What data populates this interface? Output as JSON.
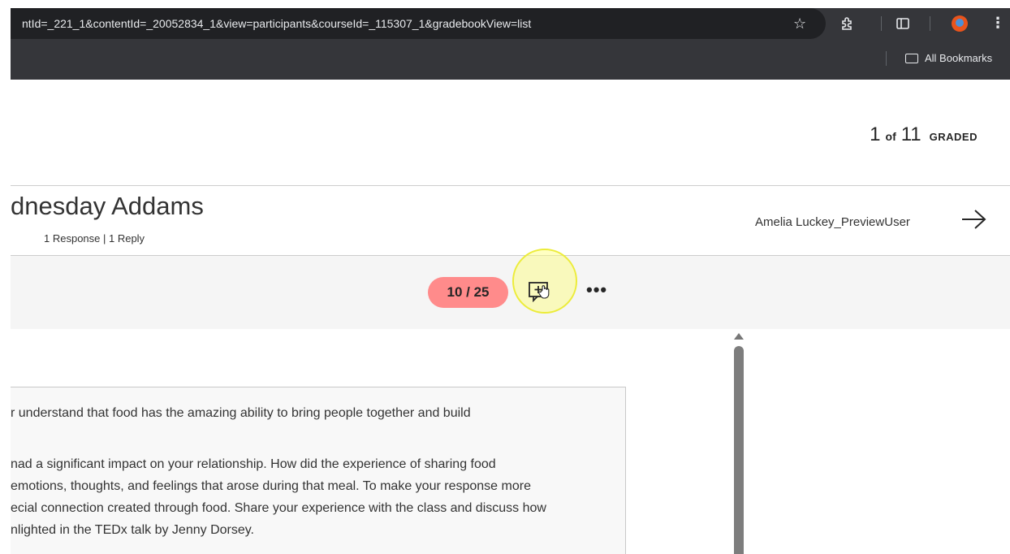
{
  "browser": {
    "url": "ntId=_221_1&contentId=_20052834_1&view=participants&courseId=_115307_1&gradebookView=list",
    "bookmarks_label": "All Bookmarks"
  },
  "progress": {
    "current": "1",
    "of": "of",
    "total": "11",
    "label": "GRADED"
  },
  "student": {
    "name": "dnesday Addams",
    "meta": "1 Response | 1 Reply"
  },
  "next_user": {
    "name": "Amelia Luckey_PreviewUser"
  },
  "grade": {
    "score": "10 / 25",
    "score_color": "#ff8b8b"
  },
  "more_label": "•••",
  "content": {
    "lines": [
      "r understand that food has the amazing ability to bring people together and build",
      "nad a significant impact on your relationship. How did the experience of sharing food",
      "emotions, thoughts, and feelings that arose during that meal. To make your response more",
      "ecial connection created through food. Share your experience with the class and discuss how",
      "nlighted in the TEDx talk by Jenny Dorsey."
    ]
  }
}
